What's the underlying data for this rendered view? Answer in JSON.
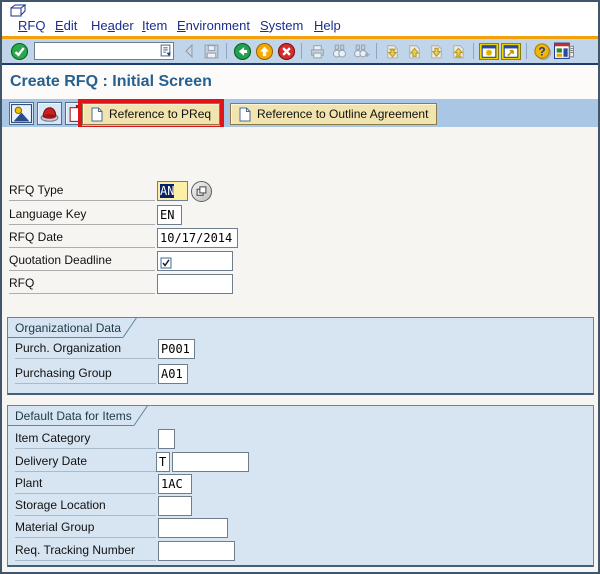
{
  "menu_bar": {
    "items": [
      {
        "pre": "",
        "key": "R",
        "post": "FQ"
      },
      {
        "pre": "",
        "key": "E",
        "post": "dit"
      },
      {
        "pre": "He",
        "key": "a",
        "post": "der"
      },
      {
        "pre": "",
        "key": "I",
        "post": "tem"
      },
      {
        "pre": "",
        "key": "E",
        "post": "nvironment"
      },
      {
        "pre": "",
        "key": "S",
        "post": "ystem"
      },
      {
        "pre": "",
        "key": "H",
        "post": "elp"
      }
    ]
  },
  "toolbar": {
    "command_value": "",
    "icons": [
      "enter-icon",
      "command-input",
      "collapse-toolbar-icon",
      "save-icon",
      "back-icon",
      "exit-icon",
      "cancel-icon",
      "print-icon",
      "find-icon",
      "find-next-icon",
      "first-page-icon",
      "previous-page-icon",
      "next-page-icon",
      "last-page-icon",
      "new-session-icon",
      "create-shortcut-icon",
      "help-icon",
      "customize-layout-icon"
    ]
  },
  "screen": {
    "title": "Create RFQ : Initial Screen"
  },
  "app_toolbar": {
    "icon_buttons": [
      "person-mountain-icon",
      "red-hat-icon",
      "copy-pages-icon"
    ],
    "buttons": [
      {
        "label": "Reference to PReq",
        "highlighted": true
      },
      {
        "label": "Reference to Outline Agreement",
        "highlighted": false
      }
    ],
    "highlight_color": "#E01318"
  },
  "form": {
    "fields": [
      {
        "label": "RFQ Type",
        "value": "AN",
        "focused": true,
        "has_matchcode": true
      },
      {
        "label": "Language Key",
        "value": "EN"
      },
      {
        "label": "RFQ Date",
        "value": "10/17/2014"
      },
      {
        "label": "Quotation Deadline",
        "value": "",
        "required": true
      },
      {
        "label": "RFQ",
        "value": ""
      }
    ]
  },
  "sections": [
    {
      "title": "Organizational Data",
      "fields": [
        {
          "label": "Purch. Organization",
          "value": "P001"
        },
        {
          "label": "Purchasing Group",
          "value": "A01"
        }
      ]
    },
    {
      "title": "Default Data for Items",
      "fields": [
        {
          "label": "Item Category",
          "value": ""
        },
        {
          "label": "Delivery Date",
          "value": "T",
          "value2": ""
        },
        {
          "label": "Plant",
          "value": "1AC"
        },
        {
          "label": "Storage Location",
          "value": ""
        },
        {
          "label": "Material Group",
          "value": ""
        },
        {
          "label": "Req. Tracking Number",
          "value": ""
        }
      ]
    }
  ],
  "colors": {
    "orange_line": "#F1A10C",
    "toolbar_bg": "#C1D5EA",
    "app_toolbar_bg": "#A9C6E5",
    "panel_bg": "#D7E4F1",
    "button_bg": "#F2E4AE",
    "highlight_red": "#E01318",
    "title_text": "#26608F",
    "focused_field_bg": "#FCF0A6",
    "selection_bg": "#0A2168"
  }
}
